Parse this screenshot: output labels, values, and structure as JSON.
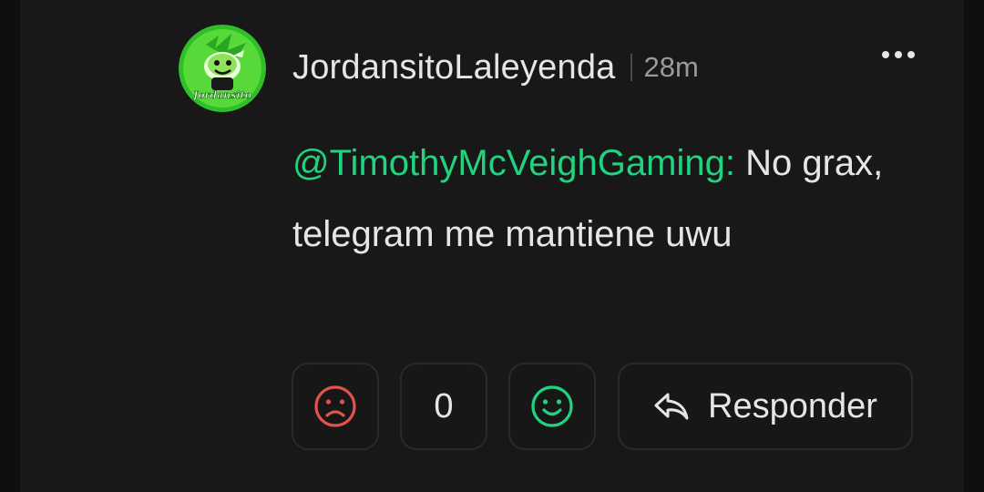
{
  "comment": {
    "author": "JordansitoLaleyenda",
    "time_ago": "28m",
    "avatar_text": "Jordansito",
    "mention": "@TimothyMcVeighGaming:",
    "text": " No grax, telegram me mantiene uwu"
  },
  "actions": {
    "dislike_icon": "sad-face-icon",
    "vote_count": "0",
    "like_icon": "happy-face-icon",
    "reply_label": "Responder",
    "reply_icon": "reply-arrow-icon",
    "more_icon": "more-horizontal-icon"
  },
  "colors": {
    "background": "#181818",
    "text": "#e6e6e6",
    "mention": "#1fd37f",
    "dislike": "#e0524b",
    "like": "#1fd37f",
    "muted": "#9a9a9a"
  }
}
